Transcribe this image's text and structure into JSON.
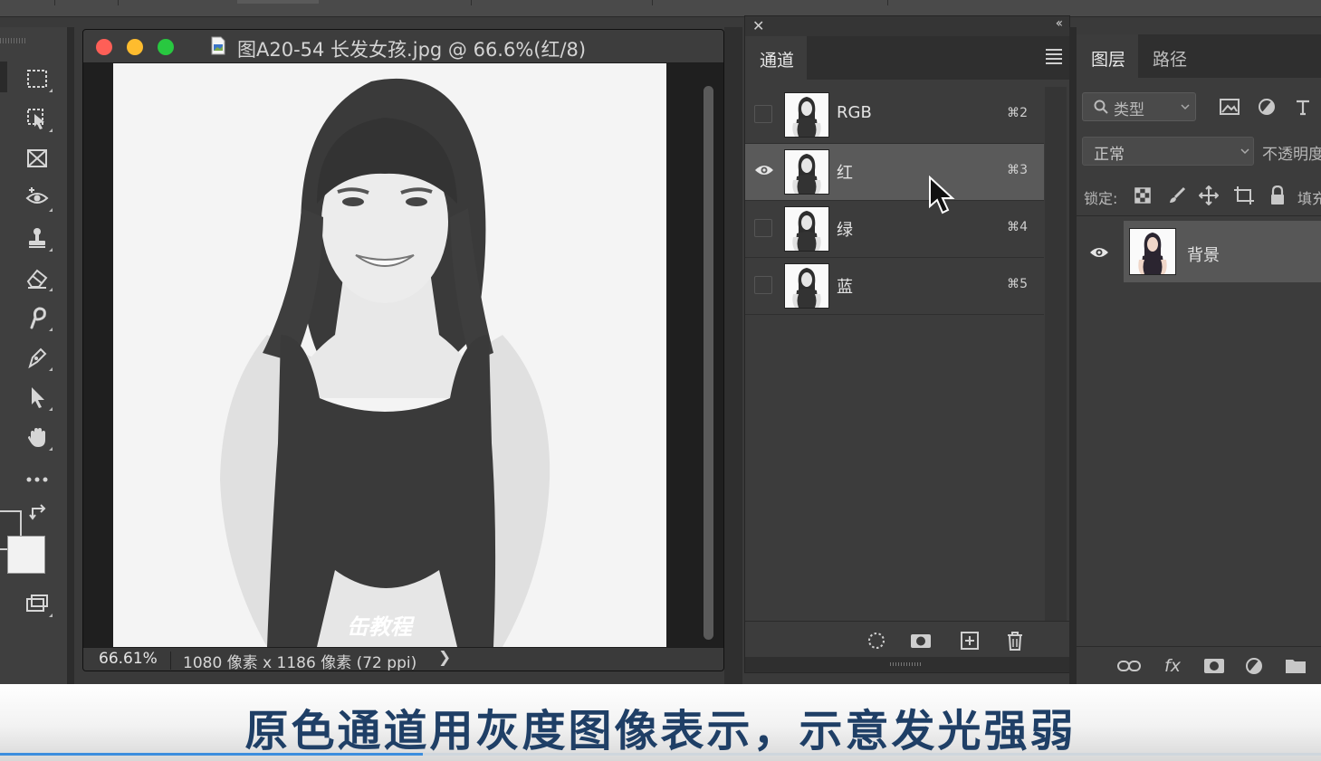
{
  "document": {
    "title": "图A20-54 长发女孩.jpg @ 66.6%(红/8)",
    "zoom": "66.61%",
    "info": "1080 像素 x 1186 像素 (72 ppi)",
    "info_arrow": "❯",
    "watermark": "缶教程"
  },
  "channels_panel": {
    "close_glyph": "✕",
    "collapse_glyph": "‹‹",
    "tab": "通道",
    "rows": [
      {
        "name": "RGB",
        "shortcut": "⌘2",
        "visible": false,
        "active": false
      },
      {
        "name": "红",
        "shortcut": "⌘3",
        "visible": true,
        "active": true
      },
      {
        "name": "绿",
        "shortcut": "⌘4",
        "visible": false,
        "active": false
      },
      {
        "name": "蓝",
        "shortcut": "⌘5",
        "visible": false,
        "active": false
      }
    ],
    "footer_icons": [
      "dotted-circle-selection-icon",
      "save-selection-mask-icon",
      "new-channel-icon",
      "trash-icon"
    ]
  },
  "layers_panel": {
    "tabs": [
      "图层",
      "路径"
    ],
    "filter_label": "类型",
    "blend_mode": "正常",
    "opacity_label": "不透明度",
    "lock_label": "锁定:",
    "fill_label": "填充",
    "layer_name": "背景",
    "footer_fx": "fx"
  },
  "caption": {
    "text": "原色通道用灰度图像表示，示意发光强弱",
    "progress": 0.32
  },
  "colors": {
    "caption_text": "#1f3f66",
    "progress": "#3d8ede",
    "close": "#fe5f57",
    "minimize": "#febc2e",
    "zoom": "#28c840"
  }
}
